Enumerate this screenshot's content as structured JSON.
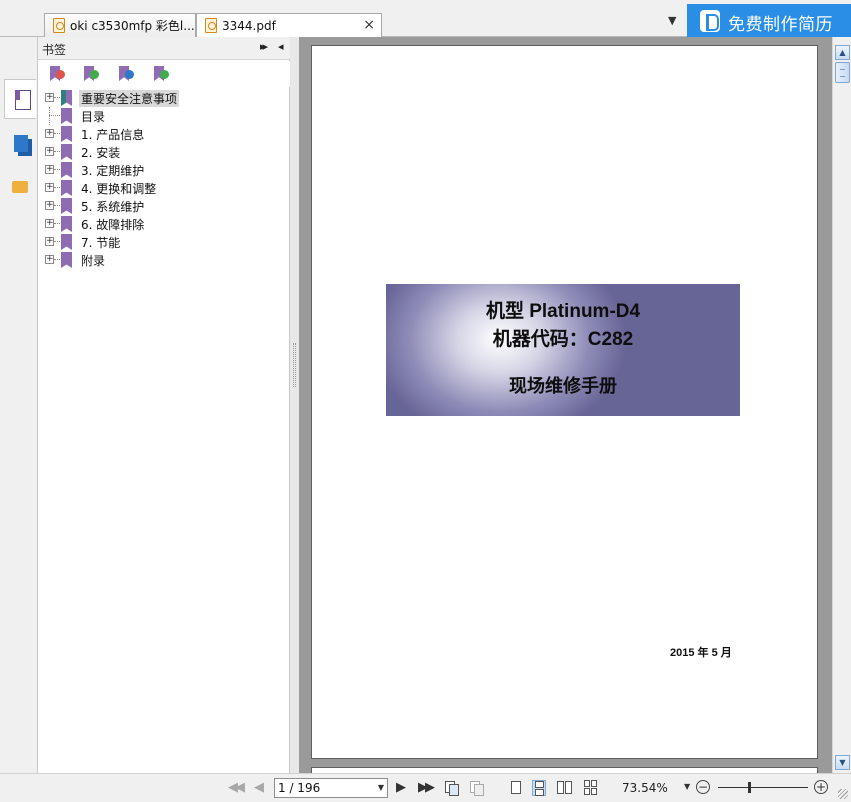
{
  "tabs": [
    {
      "label": "oki c3530mfp 彩色l...",
      "active": false
    },
    {
      "label": "3344.pdf",
      "active": true,
      "close": "×"
    }
  ],
  "tab_dropdown": "▼",
  "promo": {
    "label": "免费制作简历",
    "color": "#2b8ee6"
  },
  "sidebar": {
    "buttons": [
      {
        "icon": "bookmark-page-icon",
        "active": true
      },
      {
        "icon": "pages-thumbnail-icon",
        "active": false
      },
      {
        "icon": "comments-icon",
        "active": false
      }
    ]
  },
  "bookmarks": {
    "title": "书签",
    "collapse_icon": "▸▸",
    "hide_icon": "◂",
    "tools": [
      {
        "icon": "delete-bookmark-icon",
        "badge_color": "#e0574a"
      },
      {
        "icon": "add-bookmark-icon",
        "badge_color": "#3fae49"
      },
      {
        "icon": "goto-bookmark-icon",
        "badge_color": "#2d78c8"
      },
      {
        "icon": "bookmark-properties-icon",
        "badge_color": "#3fae49"
      }
    ],
    "items": [
      {
        "label": "重要安全注意事项",
        "expandable": true,
        "selected": true
      },
      {
        "label": "目录",
        "expandable": false,
        "selected": false
      },
      {
        "label": "1. 产品信息",
        "expandable": true,
        "selected": false
      },
      {
        "label": "2. 安装",
        "expandable": true,
        "selected": false
      },
      {
        "label": "3. 定期维护",
        "expandable": true,
        "selected": false
      },
      {
        "label": "4. 更换和调整",
        "expandable": true,
        "selected": false
      },
      {
        "label": "5. 系统维护",
        "expandable": true,
        "selected": false
      },
      {
        "label": "6. 故障排除",
        "expandable": true,
        "selected": false
      },
      {
        "label": "7. 节能",
        "expandable": true,
        "selected": false
      },
      {
        "label": "附录",
        "expandable": true,
        "selected": false
      }
    ],
    "expand_glyph": "+"
  },
  "document": {
    "banner": {
      "line1": "机型 Platinum-D4",
      "line2": "机器代码：C282",
      "line3": "现场维修手册"
    },
    "date": "2015 年 5 月"
  },
  "scrollbar": {
    "up": "▲",
    "down": "▼"
  },
  "navigation": {
    "first": "◀◀",
    "prev": "◀",
    "page_value": "1 / 196",
    "page_dropdown": "▼",
    "next": "▶",
    "last": "▶▶",
    "zoom": "73.54%",
    "zoom_dropdown": "▼",
    "zoom_out": "−",
    "zoom_in": "+",
    "zoom_slider_fraction": 0.34
  }
}
